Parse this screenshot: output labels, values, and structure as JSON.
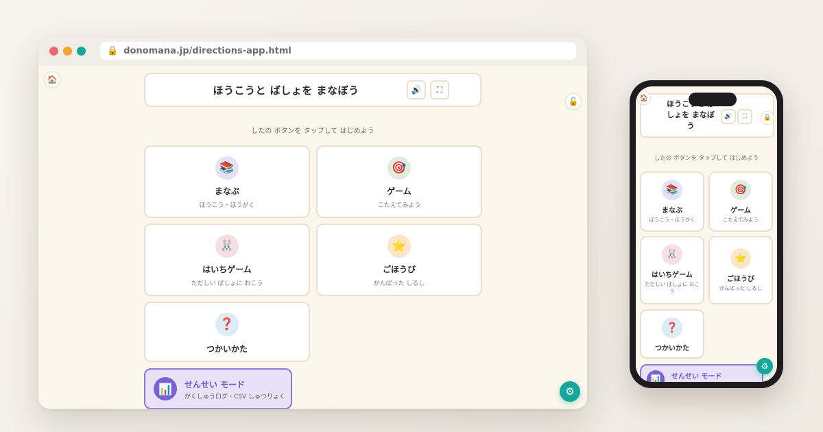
{
  "browser": {
    "url": "donomana.jp/directions-app.html"
  },
  "app": {
    "title": "ほうこうと ばしょを まなぼう",
    "title_mobile_lines": [
      "ほうこうと ば",
      "しょを まなぼ",
      "う"
    ],
    "subtitle": "したの ボタンを タップして はじめよう",
    "home_icon": "🏠",
    "lock_icon": "🔓",
    "sound_icon": "🔊",
    "fullscreen_icon": "⛶",
    "gear_icon": "⚙",
    "menu": [
      {
        "label": "まなぶ",
        "sub": "ほうこう・ほうがく",
        "icon": "📚",
        "icon_name": "books-icon",
        "bg": "#e6e0f6"
      },
      {
        "label": "ゲーム",
        "sub": "こたえてみよう",
        "icon": "🎯",
        "icon_name": "target-icon",
        "bg": "#dcefdc"
      },
      {
        "label": "はいちゲーム",
        "sub": "ただしい ばしょに おこう",
        "icon": "🐰",
        "icon_name": "rabbit-icon",
        "bg": "#f7dfe6"
      },
      {
        "label": "ごほうび",
        "sub": "がんばった しるし",
        "icon": "⭐",
        "icon_name": "star-icon",
        "bg": "#fbe7c7"
      },
      {
        "label": "つかいかた",
        "sub": "",
        "icon": "❓",
        "icon_name": "question-icon",
        "bg": "#dcebf6"
      }
    ],
    "teacher_mode": {
      "label": "せんせい モード",
      "sub": "がくしゅうログ・CSV しゅつりょく",
      "icon": "📊"
    }
  },
  "colors": {
    "accent_teal": "#15a89a",
    "teacher_purple": "#7a62d4",
    "card_border": "#ecdfcc",
    "app_bg": "#fdf6ec"
  }
}
